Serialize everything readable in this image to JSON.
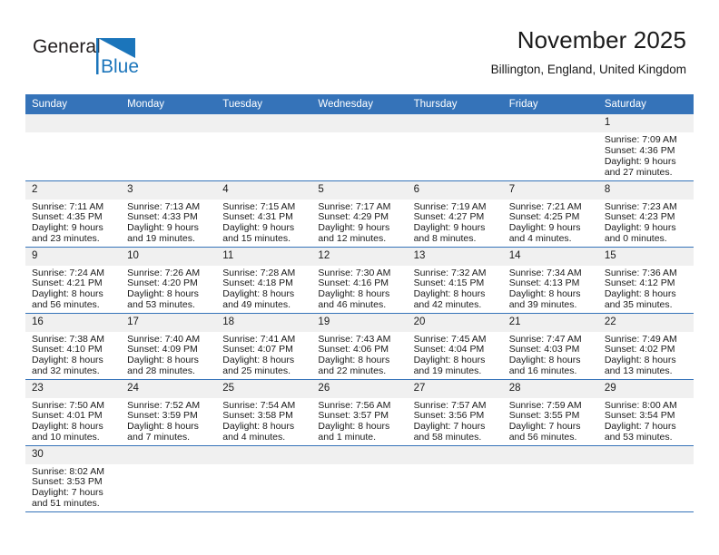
{
  "brand": {
    "name_top": "General",
    "name_bottom": "Blue",
    "logo_icon": "blue-triangle-flag-icon",
    "color_top": "#231f20",
    "color_bottom": "#1b75bb",
    "accent": "#1b75bb"
  },
  "header": {
    "title": "November 2025",
    "subtitle": "Billington, England, United Kingdom"
  },
  "theme": {
    "header_blue": "#3573b9",
    "daynum_band": "#f0f0f0",
    "grid_line": "#3573b9",
    "text": "#1a1a1a"
  },
  "weekdays": [
    "Sunday",
    "Monday",
    "Tuesday",
    "Wednesday",
    "Thursday",
    "Friday",
    "Saturday"
  ],
  "weeks": [
    [
      {
        "day": "",
        "empty": true
      },
      {
        "day": "",
        "empty": true
      },
      {
        "day": "",
        "empty": true
      },
      {
        "day": "",
        "empty": true
      },
      {
        "day": "",
        "empty": true
      },
      {
        "day": "",
        "empty": true
      },
      {
        "day": "1",
        "sunrise": "Sunrise: 7:09 AM",
        "sunset": "Sunset: 4:36 PM",
        "daylight1": "Daylight: 9 hours",
        "daylight2": "and 27 minutes."
      }
    ],
    [
      {
        "day": "2",
        "sunrise": "Sunrise: 7:11 AM",
        "sunset": "Sunset: 4:35 PM",
        "daylight1": "Daylight: 9 hours",
        "daylight2": "and 23 minutes."
      },
      {
        "day": "3",
        "sunrise": "Sunrise: 7:13 AM",
        "sunset": "Sunset: 4:33 PM",
        "daylight1": "Daylight: 9 hours",
        "daylight2": "and 19 minutes."
      },
      {
        "day": "4",
        "sunrise": "Sunrise: 7:15 AM",
        "sunset": "Sunset: 4:31 PM",
        "daylight1": "Daylight: 9 hours",
        "daylight2": "and 15 minutes."
      },
      {
        "day": "5",
        "sunrise": "Sunrise: 7:17 AM",
        "sunset": "Sunset: 4:29 PM",
        "daylight1": "Daylight: 9 hours",
        "daylight2": "and 12 minutes."
      },
      {
        "day": "6",
        "sunrise": "Sunrise: 7:19 AM",
        "sunset": "Sunset: 4:27 PM",
        "daylight1": "Daylight: 9 hours",
        "daylight2": "and 8 minutes."
      },
      {
        "day": "7",
        "sunrise": "Sunrise: 7:21 AM",
        "sunset": "Sunset: 4:25 PM",
        "daylight1": "Daylight: 9 hours",
        "daylight2": "and 4 minutes."
      },
      {
        "day": "8",
        "sunrise": "Sunrise: 7:23 AM",
        "sunset": "Sunset: 4:23 PM",
        "daylight1": "Daylight: 9 hours",
        "daylight2": "and 0 minutes."
      }
    ],
    [
      {
        "day": "9",
        "sunrise": "Sunrise: 7:24 AM",
        "sunset": "Sunset: 4:21 PM",
        "daylight1": "Daylight: 8 hours",
        "daylight2": "and 56 minutes."
      },
      {
        "day": "10",
        "sunrise": "Sunrise: 7:26 AM",
        "sunset": "Sunset: 4:20 PM",
        "daylight1": "Daylight: 8 hours",
        "daylight2": "and 53 minutes."
      },
      {
        "day": "11",
        "sunrise": "Sunrise: 7:28 AM",
        "sunset": "Sunset: 4:18 PM",
        "daylight1": "Daylight: 8 hours",
        "daylight2": "and 49 minutes."
      },
      {
        "day": "12",
        "sunrise": "Sunrise: 7:30 AM",
        "sunset": "Sunset: 4:16 PM",
        "daylight1": "Daylight: 8 hours",
        "daylight2": "and 46 minutes."
      },
      {
        "day": "13",
        "sunrise": "Sunrise: 7:32 AM",
        "sunset": "Sunset: 4:15 PM",
        "daylight1": "Daylight: 8 hours",
        "daylight2": "and 42 minutes."
      },
      {
        "day": "14",
        "sunrise": "Sunrise: 7:34 AM",
        "sunset": "Sunset: 4:13 PM",
        "daylight1": "Daylight: 8 hours",
        "daylight2": "and 39 minutes."
      },
      {
        "day": "15",
        "sunrise": "Sunrise: 7:36 AM",
        "sunset": "Sunset: 4:12 PM",
        "daylight1": "Daylight: 8 hours",
        "daylight2": "and 35 minutes."
      }
    ],
    [
      {
        "day": "16",
        "sunrise": "Sunrise: 7:38 AM",
        "sunset": "Sunset: 4:10 PM",
        "daylight1": "Daylight: 8 hours",
        "daylight2": "and 32 minutes."
      },
      {
        "day": "17",
        "sunrise": "Sunrise: 7:40 AM",
        "sunset": "Sunset: 4:09 PM",
        "daylight1": "Daylight: 8 hours",
        "daylight2": "and 28 minutes."
      },
      {
        "day": "18",
        "sunrise": "Sunrise: 7:41 AM",
        "sunset": "Sunset: 4:07 PM",
        "daylight1": "Daylight: 8 hours",
        "daylight2": "and 25 minutes."
      },
      {
        "day": "19",
        "sunrise": "Sunrise: 7:43 AM",
        "sunset": "Sunset: 4:06 PM",
        "daylight1": "Daylight: 8 hours",
        "daylight2": "and 22 minutes."
      },
      {
        "day": "20",
        "sunrise": "Sunrise: 7:45 AM",
        "sunset": "Sunset: 4:04 PM",
        "daylight1": "Daylight: 8 hours",
        "daylight2": "and 19 minutes."
      },
      {
        "day": "21",
        "sunrise": "Sunrise: 7:47 AM",
        "sunset": "Sunset: 4:03 PM",
        "daylight1": "Daylight: 8 hours",
        "daylight2": "and 16 minutes."
      },
      {
        "day": "22",
        "sunrise": "Sunrise: 7:49 AM",
        "sunset": "Sunset: 4:02 PM",
        "daylight1": "Daylight: 8 hours",
        "daylight2": "and 13 minutes."
      }
    ],
    [
      {
        "day": "23",
        "sunrise": "Sunrise: 7:50 AM",
        "sunset": "Sunset: 4:01 PM",
        "daylight1": "Daylight: 8 hours",
        "daylight2": "and 10 minutes."
      },
      {
        "day": "24",
        "sunrise": "Sunrise: 7:52 AM",
        "sunset": "Sunset: 3:59 PM",
        "daylight1": "Daylight: 8 hours",
        "daylight2": "and 7 minutes."
      },
      {
        "day": "25",
        "sunrise": "Sunrise: 7:54 AM",
        "sunset": "Sunset: 3:58 PM",
        "daylight1": "Daylight: 8 hours",
        "daylight2": "and 4 minutes."
      },
      {
        "day": "26",
        "sunrise": "Sunrise: 7:56 AM",
        "sunset": "Sunset: 3:57 PM",
        "daylight1": "Daylight: 8 hours",
        "daylight2": "and 1 minute."
      },
      {
        "day": "27",
        "sunrise": "Sunrise: 7:57 AM",
        "sunset": "Sunset: 3:56 PM",
        "daylight1": "Daylight: 7 hours",
        "daylight2": "and 58 minutes."
      },
      {
        "day": "28",
        "sunrise": "Sunrise: 7:59 AM",
        "sunset": "Sunset: 3:55 PM",
        "daylight1": "Daylight: 7 hours",
        "daylight2": "and 56 minutes."
      },
      {
        "day": "29",
        "sunrise": "Sunrise: 8:00 AM",
        "sunset": "Sunset: 3:54 PM",
        "daylight1": "Daylight: 7 hours",
        "daylight2": "and 53 minutes."
      }
    ],
    [
      {
        "day": "30",
        "sunrise": "Sunrise: 8:02 AM",
        "sunset": "Sunset: 3:53 PM",
        "daylight1": "Daylight: 7 hours",
        "daylight2": "and 51 minutes."
      },
      {
        "day": "",
        "empty": true
      },
      {
        "day": "",
        "empty": true
      },
      {
        "day": "",
        "empty": true
      },
      {
        "day": "",
        "empty": true
      },
      {
        "day": "",
        "empty": true
      },
      {
        "day": "",
        "empty": true
      }
    ]
  ]
}
